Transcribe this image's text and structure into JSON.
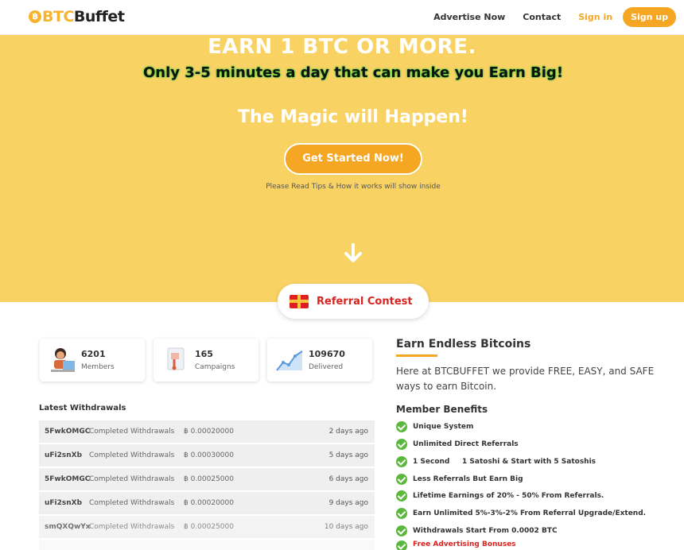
{
  "header": {
    "logo_btc": "BTC",
    "logo_rest": "Buffet",
    "nav": {
      "advertise": "Advertise Now",
      "contact": "Contact",
      "signin": "Sign in",
      "signup": "Sign up"
    }
  },
  "hero": {
    "title": "EARN 1 BTC OR MORE.",
    "subtitle": "Only 3-5 minutes a day that can make you Earn Big!",
    "magic": "The Magic will Happen!",
    "cta": "Get Started Now!",
    "hint": "Please Read Tips & How it works will show inside"
  },
  "referral": {
    "label": "Referral Contest"
  },
  "stats": [
    {
      "value": "6201",
      "label": "Members",
      "icon": "members-icon"
    },
    {
      "value": "165",
      "label": "Campaigns",
      "icon": "campaigns-icon"
    },
    {
      "value": "109670",
      "label": "Delivered",
      "icon": "delivered-icon"
    }
  ],
  "withdrawals": {
    "title": "Latest Withdrawals",
    "rows": [
      {
        "user": "5FwkOMGC",
        "text": "Completed Withdrawals",
        "amount": "฿ 0.00020000",
        "ago": "2 days ago"
      },
      {
        "user": "uFi2snXb",
        "text": "Completed Withdrawals",
        "amount": "฿ 0.00030000",
        "ago": "5 days ago"
      },
      {
        "user": "5FwkOMGC",
        "text": "Completed Withdrawals",
        "amount": "฿ 0.00025000",
        "ago": "6 days ago"
      },
      {
        "user": "uFi2snXb",
        "text": "Completed Withdrawals",
        "amount": "฿ 0.00020000",
        "ago": "9 days ago"
      },
      {
        "user": "smQXQwYx",
        "text": "Completed Withdrawals",
        "amount": "฿ 0.00025000",
        "ago": "10 days ago"
      }
    ]
  },
  "earn": {
    "title": "Earn Endless Bitcoins",
    "text": "Here at BTCBUFFET we provide FREE, EASY, and SAFE ways to earn Bitcoin."
  },
  "benefits": {
    "title": "Member Benefits",
    "items": [
      "Unique System",
      "Unlimited Direct Referrals",
      "1 Second     1 Satoshi & Start with 5 Satoshis",
      "Less Referrals But Earn Big",
      "Lifetime Earnings of 20% - 50% From Referrals.",
      "Earn Unlimited 5%-3%-2% From Referral Upgrade/Extend.",
      "Withdrawals Start From 0.0002 BTC",
      "Free Advertising Bonuses"
    ]
  },
  "colors": {
    "accent": "#f5a623",
    "hero_bg": "#f9d264",
    "check": "#5cb83c",
    "red": "#d9231f"
  }
}
